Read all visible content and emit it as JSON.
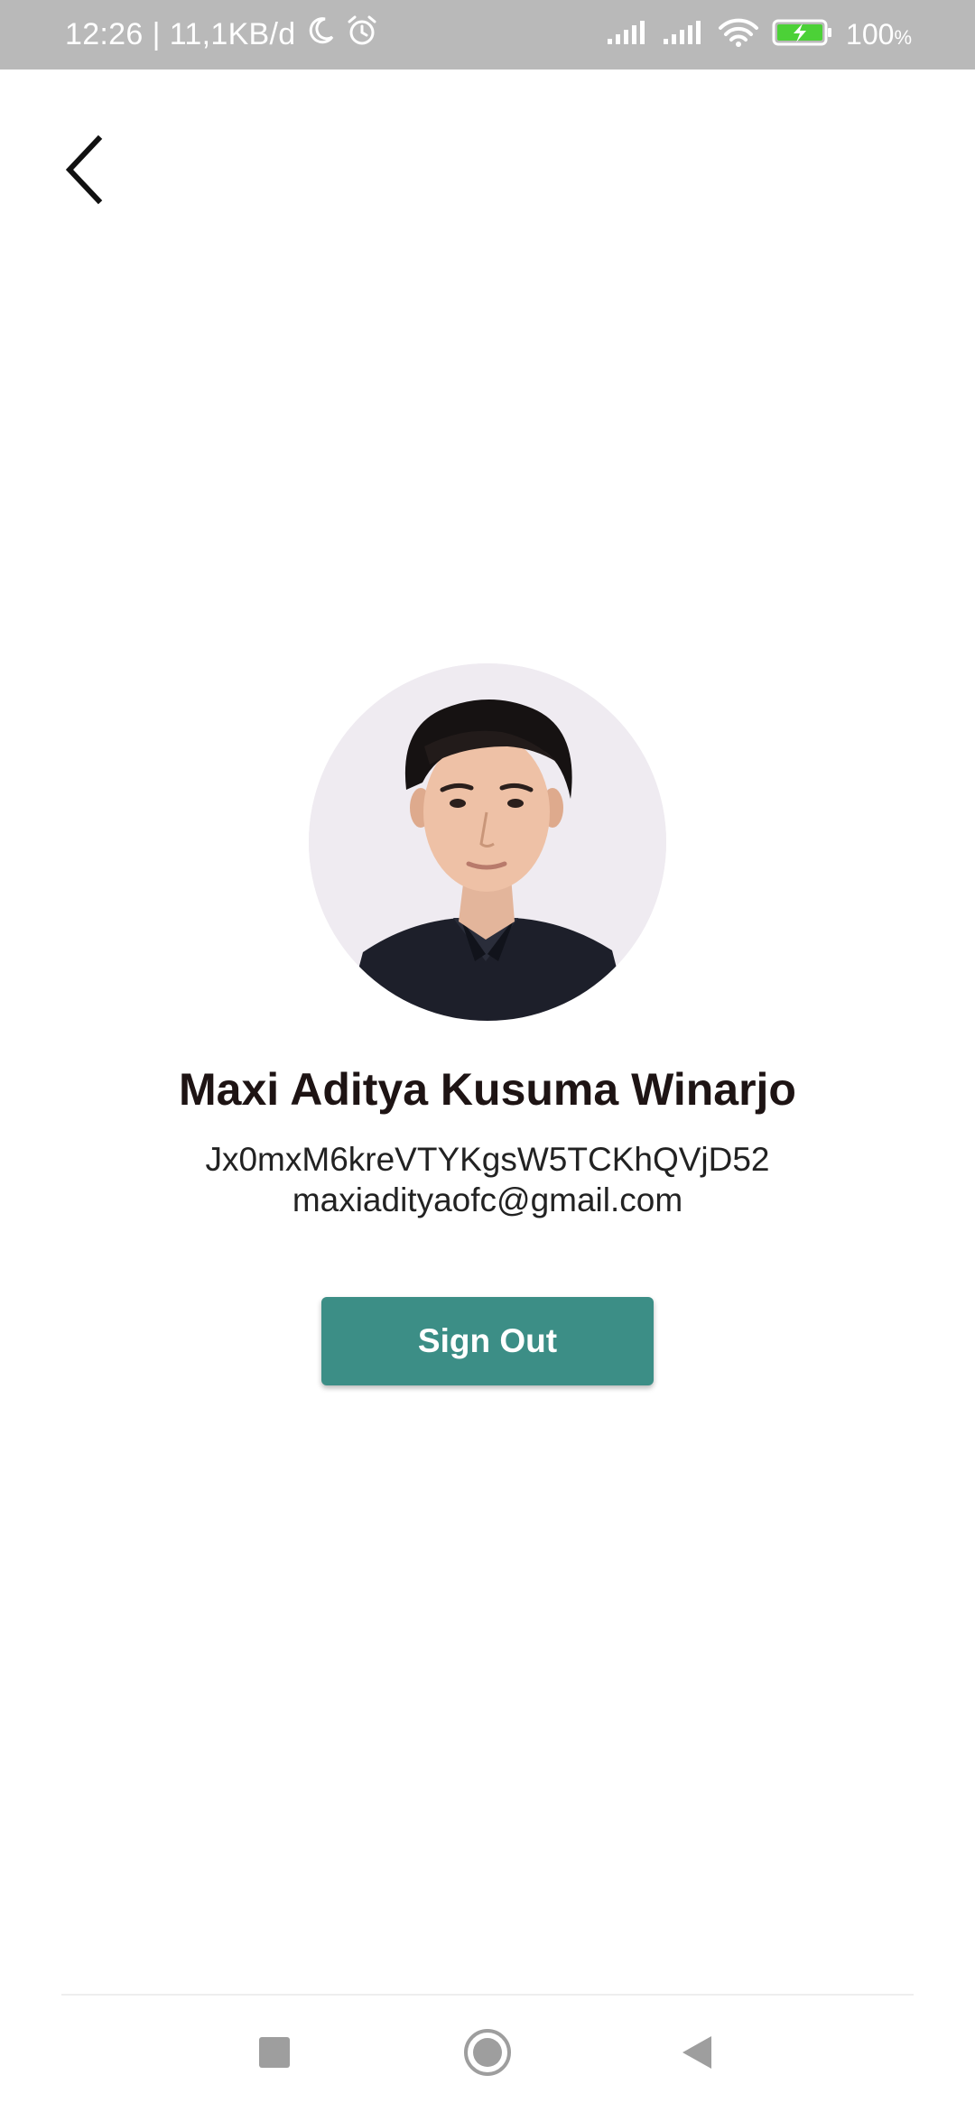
{
  "status_bar": {
    "time": "12:26",
    "separator": "|",
    "network_speed": "11,1KB/d",
    "battery_percent": "100",
    "battery_unit": "%",
    "icons": [
      "moon-icon",
      "alarm-icon",
      "signal-icon",
      "signal-icon",
      "wifi-icon",
      "battery-charging-icon"
    ]
  },
  "header": {
    "back_icon": "chevron-left-icon"
  },
  "profile": {
    "name": "Maxi Aditya Kusuma Winarjo",
    "uid": "Jx0mxM6kreVTYKgsW5TCKhQVjD52",
    "email": "maxiadityaofc@gmail.com"
  },
  "actions": {
    "sign_out_label": "Sign Out"
  },
  "colors": {
    "status_bar_bg": "#b9b9b9",
    "accent": "#3c8e86",
    "name_text": "#1e1414",
    "battery_fill": "#4cd137"
  },
  "nav_bar": {
    "icons": [
      "recents-square-icon",
      "home-circle-icon",
      "back-triangle-icon"
    ]
  }
}
